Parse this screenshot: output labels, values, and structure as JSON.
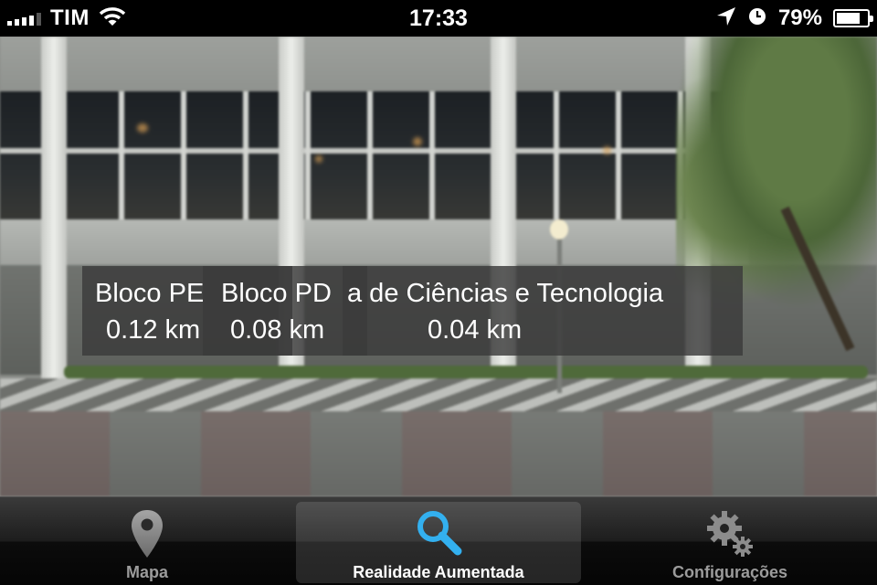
{
  "status_bar": {
    "carrier": "TIM",
    "time": "17:33",
    "battery": "79%",
    "battery_level": 0.79,
    "icons": [
      "signal-icon",
      "wifi-icon",
      "location-arrow-icon",
      "alarm-clock-icon",
      "battery-icon"
    ]
  },
  "camera": {
    "labels": [
      {
        "name": "Bloco PE",
        "distance": "0.12 km"
      },
      {
        "name": "Bloco PD",
        "distance": "0.08 km"
      },
      {
        "name": "a de Ciências e Tecnologia",
        "distance": "0.04 km"
      }
    ]
  },
  "tab_bar": {
    "tabs": [
      {
        "label": "Mapa",
        "icon": "map-pin-icon",
        "selected": false
      },
      {
        "label": "Realidade Aumentada",
        "icon": "magnifier-icon",
        "selected": true
      },
      {
        "label": "Configurações",
        "icon": "gears-icon",
        "selected": false
      }
    ],
    "colors": {
      "active_label": "#ffffff",
      "inactive_label": "#9b9b9b",
      "search_accent": "#33b0ef"
    }
  }
}
